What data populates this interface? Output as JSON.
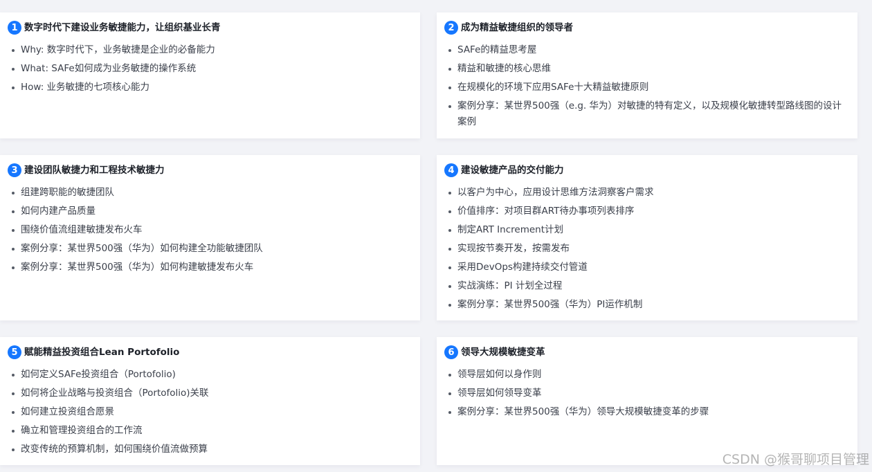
{
  "accent_color": "#1677ff",
  "cards": [
    {
      "number": "1",
      "title": "数字时代下建设业务敏捷能力，让组织基业长青",
      "items": [
        "Why: 数字时代下，业务敏捷是企业的必备能力",
        "What: SAFe如何成为业务敏捷的操作系统",
        "How: 业务敏捷的七项核心能力"
      ]
    },
    {
      "number": "2",
      "title": "成为精益敏捷组织的领导者",
      "items": [
        "SAFe的精益思考屋",
        "精益和敏捷的核心思维",
        "在规模化的环境下应用SAFe十大精益敏捷原则",
        "案例分享：某世界500强（e.g. 华为）对敏捷的特有定义，以及规模化敏捷转型路线图的设计案例"
      ]
    },
    {
      "number": "3",
      "title": "建设团队敏捷力和工程技术敏捷力",
      "items": [
        "组建跨职能的敏捷团队",
        "如何内建产品质量",
        "围绕价值流组建敏捷发布火车",
        "案例分享：某世界500强（华为）如何构建全功能敏捷团队",
        "案例分享：某世界500强（华为）如何构建敏捷发布火车"
      ]
    },
    {
      "number": "4",
      "title": "建设敏捷产品的交付能力",
      "items": [
        "以客户为中心，应用设计思维方法洞察客户需求",
        "价值排序：对项目群ART待办事项列表排序",
        "制定ART Increment计划",
        "实现按节奏开发，按需发布",
        "采用DevOps构建持续交付管道",
        "实战演练：PI 计划全过程",
        "案例分享：某世界500强（华为）PI运作机制"
      ]
    },
    {
      "number": "5",
      "title": "赋能精益投资组合Lean Portofolio",
      "items": [
        "如何定义SAFe投资组合（Portofolio)",
        "如何将企业战略与投资组合（Portofolio)关联",
        "如何建立投资组合愿景",
        "确立和管理投资组合的工作流",
        "改变传统的预算机制，如何围绕价值流做预算"
      ]
    },
    {
      "number": "6",
      "title": "领导大规模敏捷变革",
      "items": [
        "领导层如何以身作则",
        "领导层如何领导变革",
        "案例分享：某世界500强（华为）领导大规模敏捷变革的步骤"
      ]
    }
  ],
  "watermark": "CSDN @猴哥聊项目管理"
}
